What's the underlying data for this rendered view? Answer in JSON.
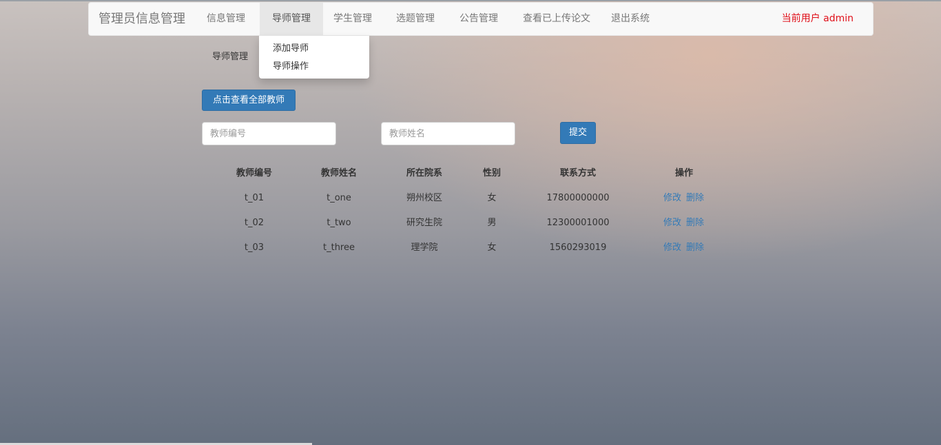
{
  "navbar": {
    "brand": "管理员信息管理",
    "items": [
      {
        "label": "信息管理"
      },
      {
        "label": "导师管理"
      },
      {
        "label": "学生管理"
      },
      {
        "label": "选题管理"
      },
      {
        "label": "公告管理"
      },
      {
        "label": "查看已上传论文"
      },
      {
        "label": "退出系统"
      }
    ],
    "current_user": "当前用户 admin"
  },
  "dropdown": {
    "items": [
      {
        "label": "添加导师"
      },
      {
        "label": "导师操作"
      }
    ]
  },
  "section_label": "导师管理",
  "actions": {
    "view_all_label": "点击查看全部教师",
    "teacher_id_placeholder": "教师编号",
    "teacher_name_placeholder": "教师姓名",
    "submit_label": "提交"
  },
  "table": {
    "headers": [
      "教师编号",
      "教师姓名",
      "所在院系",
      "性别",
      "联系方式",
      "操作"
    ],
    "rows": [
      {
        "id": "t_01",
        "name": "t_one",
        "dept": "朔州校区",
        "gender": "女",
        "phone": "17800000000",
        "edit": "修改",
        "delete": "删除"
      },
      {
        "id": "t_02",
        "name": "t_two",
        "dept": "研究生院",
        "gender": "男",
        "phone": "12300001000",
        "edit": "修改",
        "delete": "删除"
      },
      {
        "id": "t_03",
        "name": "t_three",
        "dept": "理学院",
        "gender": "女",
        "phone": "1560293019",
        "edit": "修改",
        "delete": "删除"
      }
    ]
  },
  "colors": {
    "primary": "#337ab7",
    "user_text": "#e0101a"
  }
}
